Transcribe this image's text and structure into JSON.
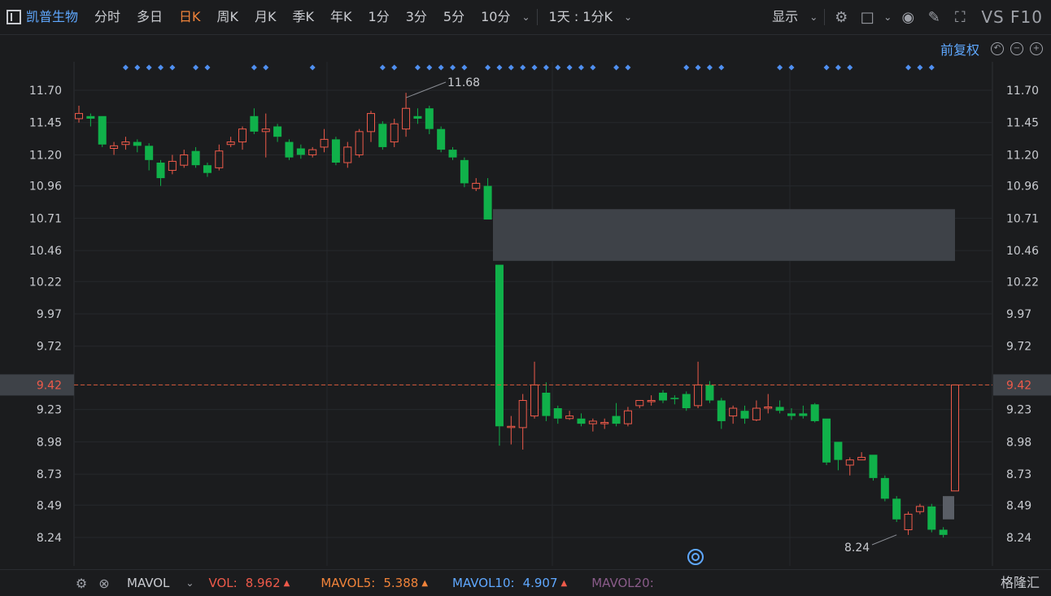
{
  "toolbar": {
    "stock_name": "凯普生物",
    "periods": [
      "分时",
      "多日",
      "日K",
      "周K",
      "月K",
      "季K",
      "年K",
      "1分",
      "3分",
      "5分",
      "10分"
    ],
    "active_period": "日K",
    "multi_period": "1天 : 1分K",
    "display": "显示",
    "vs_f10": "VS F10"
  },
  "sub_bar": {
    "adjust": "前复权"
  },
  "chart_data": {
    "type": "candlestick",
    "y_ticks": [
      "11.70",
      "11.45",
      "11.20",
      "10.96",
      "10.71",
      "10.46",
      "10.22",
      "9.97",
      "9.72",
      "9.42",
      "9.23",
      "8.98",
      "8.73",
      "8.49",
      "8.24"
    ],
    "ylim": [
      8.02,
      11.92
    ],
    "current_price": "9.42",
    "max_label": "11.68",
    "min_label": "8.24",
    "gap_zone": [
      10.38,
      10.78
    ],
    "candles": [
      [
        11.48,
        11.52,
        11.58,
        11.45
      ],
      [
        11.5,
        11.48,
        11.52,
        11.42
      ],
      [
        11.5,
        11.28,
        11.5,
        11.26
      ],
      [
        11.25,
        11.27,
        11.3,
        11.2
      ],
      [
        11.28,
        11.3,
        11.34,
        11.24
      ],
      [
        11.3,
        11.27,
        11.32,
        11.22
      ],
      [
        11.27,
        11.16,
        11.29,
        11.08
      ],
      [
        11.14,
        11.02,
        11.16,
        10.96
      ],
      [
        11.08,
        11.15,
        11.2,
        11.05
      ],
      [
        11.12,
        11.2,
        11.24,
        11.1
      ],
      [
        11.23,
        11.12,
        11.26,
        11.1
      ],
      [
        11.12,
        11.06,
        11.14,
        11.03
      ],
      [
        11.1,
        11.23,
        11.28,
        11.08
      ],
      [
        11.28,
        11.3,
        11.34,
        11.26
      ],
      [
        11.3,
        11.4,
        11.42,
        11.24
      ],
      [
        11.5,
        11.38,
        11.56,
        11.36
      ],
      [
        11.38,
        11.4,
        11.52,
        11.18
      ],
      [
        11.42,
        11.34,
        11.44,
        11.3
      ],
      [
        11.3,
        11.18,
        11.32,
        11.16
      ],
      [
        11.25,
        11.2,
        11.28,
        11.17
      ],
      [
        11.2,
        11.24,
        11.26,
        11.18
      ],
      [
        11.26,
        11.32,
        11.4,
        11.22
      ],
      [
        11.32,
        11.14,
        11.34,
        11.12
      ],
      [
        11.14,
        11.26,
        11.3,
        11.1
      ],
      [
        11.2,
        11.38,
        11.4,
        11.18
      ],
      [
        11.38,
        11.52,
        11.54,
        11.3
      ],
      [
        11.44,
        11.26,
        11.46,
        11.24
      ],
      [
        11.3,
        11.44,
        11.48,
        11.26
      ],
      [
        11.4,
        11.56,
        11.68,
        11.34
      ],
      [
        11.5,
        11.48,
        11.56,
        11.44
      ],
      [
        11.56,
        11.4,
        11.58,
        11.36
      ],
      [
        11.4,
        11.24,
        11.42,
        11.22
      ],
      [
        11.24,
        11.18,
        11.26,
        11.16
      ],
      [
        11.16,
        10.98,
        11.18,
        10.95
      ],
      [
        10.94,
        10.98,
        11.02,
        10.92
      ],
      [
        10.96,
        10.7,
        11.02,
        10.7
      ],
      [
        10.35,
        9.1,
        10.35,
        8.95
      ],
      [
        9.1,
        9.1,
        9.18,
        8.96
      ],
      [
        9.09,
        9.3,
        9.35,
        8.92
      ],
      [
        9.18,
        9.42,
        9.6,
        9.16
      ],
      [
        9.36,
        9.18,
        9.44,
        9.14
      ],
      [
        9.24,
        9.16,
        9.26,
        9.12
      ],
      [
        9.16,
        9.18,
        9.22,
        9.15
      ],
      [
        9.16,
        9.12,
        9.2,
        9.1
      ],
      [
        9.12,
        9.14,
        9.16,
        9.06
      ],
      [
        9.12,
        9.13,
        9.16,
        9.08
      ],
      [
        9.18,
        9.12,
        9.28,
        9.1
      ],
      [
        9.12,
        9.22,
        9.25,
        9.1
      ],
      [
        9.26,
        9.3,
        9.3,
        9.24
      ],
      [
        9.3,
        9.3,
        9.34,
        9.26
      ],
      [
        9.36,
        9.3,
        9.38,
        9.28
      ],
      [
        9.32,
        9.31,
        9.34,
        9.27
      ],
      [
        9.35,
        9.24,
        9.37,
        9.22
      ],
      [
        9.26,
        9.42,
        9.6,
        9.24
      ],
      [
        9.42,
        9.3,
        9.45,
        9.28
      ],
      [
        9.3,
        9.14,
        9.32,
        9.08
      ],
      [
        9.18,
        9.24,
        9.26,
        9.12
      ],
      [
        9.22,
        9.16,
        9.26,
        9.12
      ],
      [
        9.15,
        9.24,
        9.3,
        9.14
      ],
      [
        9.24,
        9.25,
        9.35,
        9.2
      ],
      [
        9.25,
        9.22,
        9.3,
        9.2
      ],
      [
        9.2,
        9.18,
        9.24,
        9.15
      ],
      [
        9.2,
        9.18,
        9.26,
        9.16
      ],
      [
        9.27,
        9.14,
        9.28,
        9.13
      ],
      [
        9.16,
        8.82,
        9.16,
        8.8
      ],
      [
        8.98,
        8.84,
        8.98,
        8.76
      ],
      [
        8.8,
        8.84,
        8.86,
        8.72
      ],
      [
        8.84,
        8.86,
        8.9,
        8.84
      ],
      [
        8.88,
        8.7,
        8.88,
        8.68
      ],
      [
        8.7,
        8.54,
        8.72,
        8.52
      ],
      [
        8.54,
        8.38,
        8.56,
        8.36
      ],
      [
        8.3,
        8.42,
        8.44,
        8.26
      ],
      [
        8.44,
        8.48,
        8.5,
        8.42
      ],
      [
        8.48,
        8.3,
        8.5,
        8.28
      ],
      [
        8.3,
        8.26,
        8.32,
        8.24
      ],
      [
        8.6,
        9.42,
        9.42,
        8.6
      ]
    ],
    "last_box": [
      8.38,
      8.56
    ],
    "markers": [
      4,
      5,
      6,
      7,
      8,
      10,
      11,
      15,
      16,
      20,
      26,
      27,
      29,
      30,
      31,
      32,
      33,
      35,
      36,
      37,
      38,
      39,
      40,
      41,
      42,
      43,
      44,
      46,
      47,
      52,
      53,
      54,
      55,
      60,
      61,
      64,
      65,
      66,
      71,
      72,
      73
    ]
  },
  "indicator": {
    "name": "MAVOL",
    "vol_label": "VOL:",
    "vol_value": "8.962",
    "ma5_label": "MAVOL5:",
    "ma5_value": "5.388",
    "ma10_label": "MAVOL10:",
    "ma10_value": "4.907",
    "ma20_label": "MAVOL20:"
  },
  "logo": "格隆汇",
  "colors": {
    "up": "#ee5a4a",
    "down": "#10b14a",
    "marker": "#4f8ff0",
    "gap": "#3e4248"
  }
}
